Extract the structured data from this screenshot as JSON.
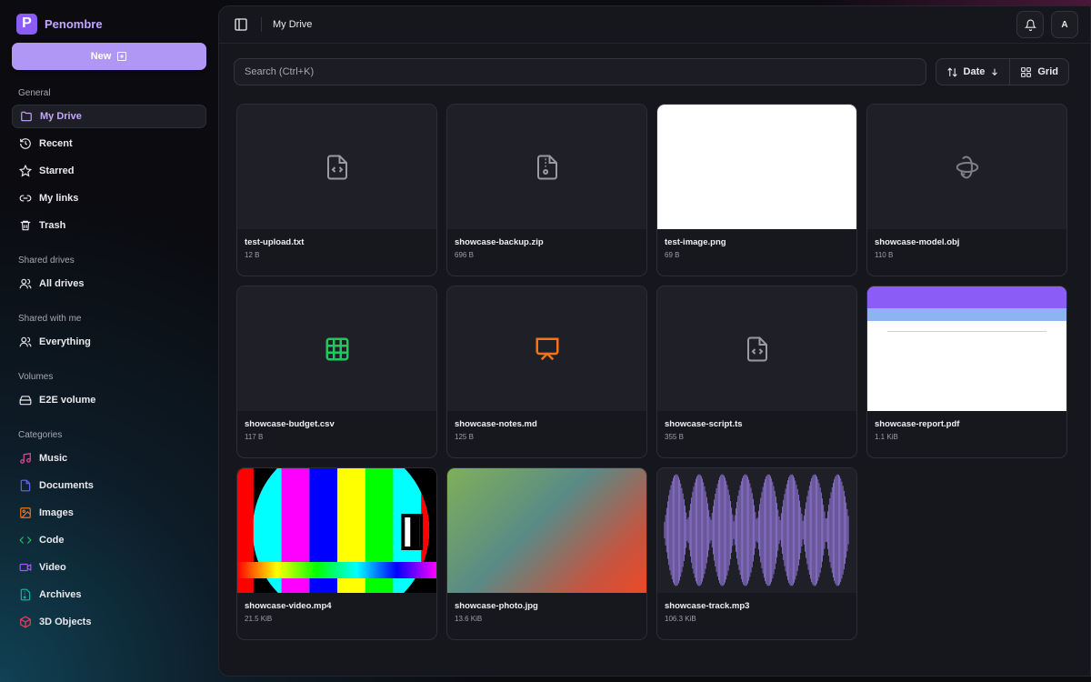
{
  "brand": {
    "logo_letter": "P",
    "name": "Penombre"
  },
  "new_button": {
    "label": "New"
  },
  "sidebar": {
    "general_title": "General",
    "general": [
      {
        "label": "My Drive",
        "icon": "folder-icon"
      },
      {
        "label": "Recent",
        "icon": "history-icon"
      },
      {
        "label": "Starred",
        "icon": "star-icon"
      },
      {
        "label": "My links",
        "icon": "link-icon"
      },
      {
        "label": "Trash",
        "icon": "trash-icon"
      }
    ],
    "shared_drives_title": "Shared drives",
    "shared_drives": [
      {
        "label": "All drives",
        "icon": "users-icon"
      }
    ],
    "shared_with_me_title": "Shared with me",
    "shared_with_me": [
      {
        "label": "Everything",
        "icon": "users-icon"
      }
    ],
    "volumes_title": "Volumes",
    "volumes": [
      {
        "label": "E2E volume",
        "icon": "hard-drive-icon"
      }
    ],
    "categories_title": "Categories",
    "categories": [
      {
        "label": "Music",
        "icon": "music-icon",
        "color": "#ec4899"
      },
      {
        "label": "Documents",
        "icon": "document-icon",
        "color": "#6366f1"
      },
      {
        "label": "Images",
        "icon": "image-icon",
        "color": "#f97316"
      },
      {
        "label": "Code",
        "icon": "code-icon",
        "color": "#22c55e"
      },
      {
        "label": "Video",
        "icon": "video-icon",
        "color": "#a855f7"
      },
      {
        "label": "Archives",
        "icon": "archive-icon",
        "color": "#14b8a6"
      },
      {
        "label": "3D Objects",
        "icon": "cube-icon",
        "color": "#f43f5e"
      }
    ]
  },
  "topbar": {
    "title": "My Drive",
    "avatar_letter": "A"
  },
  "toolbar": {
    "search_placeholder": "Search (Ctrl+K)",
    "sort_label": "Date",
    "view_label": "Grid"
  },
  "files": [
    {
      "name": "test-upload.txt",
      "size": "12 B"
    },
    {
      "name": "showcase-backup.zip",
      "size": "696 B"
    },
    {
      "name": "test-image.png",
      "size": "69 B"
    },
    {
      "name": "showcase-model.obj",
      "size": "110 B"
    },
    {
      "name": "showcase-budget.csv",
      "size": "117 B"
    },
    {
      "name": "showcase-notes.md",
      "size": "125 B"
    },
    {
      "name": "showcase-script.ts",
      "size": "355 B"
    },
    {
      "name": "showcase-report.pdf",
      "size": "1.1 KiB"
    },
    {
      "name": "showcase-video.mp4",
      "size": "21.5 KiB"
    },
    {
      "name": "showcase-photo.jpg",
      "size": "13.6 KiB"
    },
    {
      "name": "showcase-track.mp3",
      "size": "106.3 KiB"
    }
  ],
  "colors": {
    "accent": "#8b5cf6",
    "accent_light": "#b197f5",
    "csv_icon": "#22c55e",
    "slides_icon": "#f97316"
  }
}
